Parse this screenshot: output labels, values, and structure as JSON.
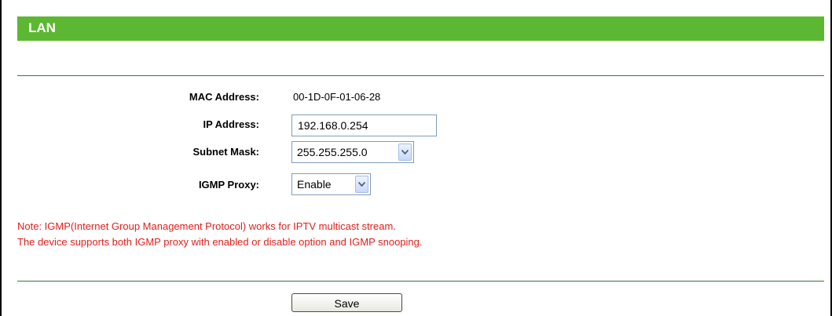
{
  "section": {
    "title": "LAN"
  },
  "fields": {
    "mac": {
      "label": "MAC Address:",
      "value": "00-1D-0F-01-06-28"
    },
    "ip": {
      "label": "IP Address:",
      "value": "192.168.0.254"
    },
    "subnet": {
      "label": "Subnet Mask:",
      "value": "255.255.255.0"
    },
    "igmp": {
      "label": "IGMP Proxy:",
      "value": "Enable"
    }
  },
  "note": {
    "line1": "Note: IGMP(Internet Group Management Protocol) works for IPTV multicast stream.",
    "line2": "The device supports both IGMP proxy with enabled or disable option and IGMP snooping."
  },
  "actions": {
    "save_label": "Save"
  },
  "colors": {
    "header": "#5cb832",
    "divider": "#2f7a3d",
    "note_text": "#e0201b"
  }
}
